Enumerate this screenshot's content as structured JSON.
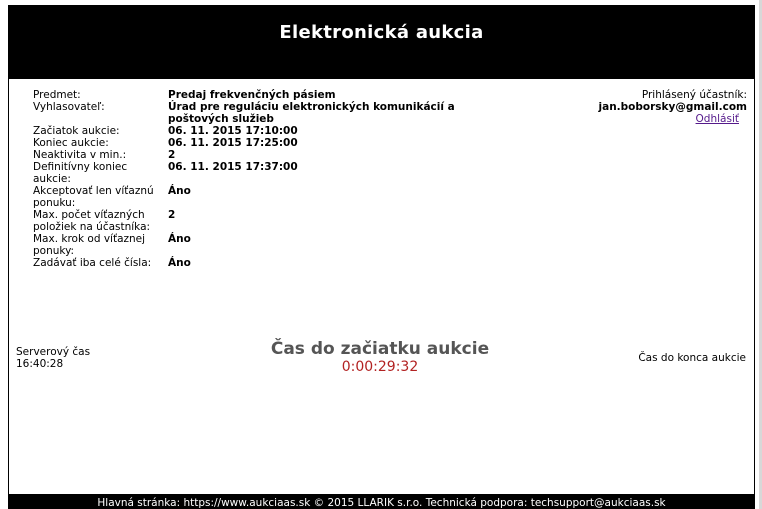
{
  "header": {
    "title": "Elektronická aukcia"
  },
  "auction": {
    "rows": [
      {
        "label": "Predmet:",
        "value": "Predaj frekvenčných pásiem"
      },
      {
        "label": "Vyhlasovateľ:",
        "value": "Úrad pre reguláciu elektronických komunikácií a poštových služieb"
      },
      {
        "label": "Začiatok aukcie:",
        "value": "06. 11. 2015 17:10:00"
      },
      {
        "label": "Koniec aukcie:",
        "value": "06. 11. 2015 17:25:00"
      },
      {
        "label": "Neaktivita v min.:",
        "value": "2"
      },
      {
        "label": "Definitívny koniec aukcie:",
        "value": "06. 11. 2015 17:37:00"
      },
      {
        "label": "Akceptovať len víťaznú ponuku:",
        "value": "Áno"
      },
      {
        "label": "Max. počet víťazných položiek na účastníka:",
        "value": "2"
      },
      {
        "label": "Max. krok od víťaznej ponuky:",
        "value": "Áno"
      },
      {
        "label": "Zadávať iba celé čísla:",
        "value": "Áno"
      }
    ]
  },
  "user": {
    "label": "Prihlásený účastník:",
    "email": "jan.boborsky@gmail.com",
    "logout": "Odhlásiť"
  },
  "server_time": {
    "label": "Serverový čas",
    "value": "16:40:28"
  },
  "countdown": {
    "title": "Čas do začiatku aukcie",
    "value": "0:00:29:32"
  },
  "end_time": {
    "label": "Čas do konca aukcie"
  },
  "footer": {
    "text": "Hlavná stránka: https://www.aukciaas.sk © 2015 LLARIK s.r.o. Technická podpora: techsupport@aukciaas.sk"
  }
}
